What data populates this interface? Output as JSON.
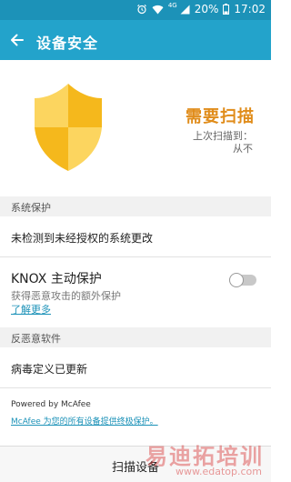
{
  "status_bar": {
    "network": "4G",
    "battery": "20%",
    "time": "17:02"
  },
  "app_bar": {
    "title": "设备安全"
  },
  "hero": {
    "status": "需要扫描",
    "last_scan_label": "上次扫描到：",
    "last_scan_value": "从不"
  },
  "system_protection": {
    "header": "系统保护",
    "unauthorized_changes": "未检测到未经授权的系统更改",
    "knox": {
      "title": "KNOX 主动保护",
      "subtitle": "获得恶意攻击的额外保护",
      "learn_more": "了解更多",
      "enabled": false
    }
  },
  "anti_malware": {
    "header": "反恶意软件",
    "virus_definitions": "病毒定义已更新"
  },
  "footer": {
    "powered_by": "Powered by McAfee",
    "mcafee_link": "McAfee 为您的所有设备提供终极保护。"
  },
  "bottom": {
    "scan_button": "扫描设备"
  },
  "watermark": {
    "chinese": "易迪拓培训",
    "url": "www.edatop.com"
  },
  "colors": {
    "status_bar": "#1c92b8",
    "app_bar": "#23a3cb",
    "accent_orange": "#e08c1a",
    "shield_light": "#fcd55f",
    "shield_dark": "#f5b81c",
    "link": "#1c92b8"
  },
  "icons": {
    "back": "arrow-left-icon",
    "alarm": "alarm-clock-icon",
    "wifi": "wifi-icon",
    "signal": "cell-signal-icon",
    "battery": "battery-icon",
    "shield": "shield-icon"
  }
}
